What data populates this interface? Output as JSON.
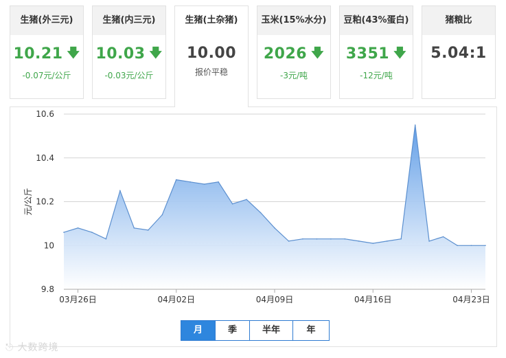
{
  "cards": [
    {
      "title": "生猪(外三元)",
      "price": "10.21",
      "change": "-0.07元/公斤",
      "trend": "down"
    },
    {
      "title": "生猪(内三元)",
      "price": "10.03",
      "change": "-0.03元/公斤",
      "trend": "down"
    },
    {
      "title": "生猪(土杂猪)",
      "price": "10.00",
      "change": "报价平稳",
      "trend": "flat"
    },
    {
      "title": "玉米(15%水分)",
      "price": "2026",
      "change": "-3元/吨",
      "trend": "down"
    },
    {
      "title": "豆粕(43%蛋白)",
      "price": "3351",
      "change": "-12元/吨",
      "trend": "down"
    },
    {
      "title": "猪粮比",
      "price": "5.04:1",
      "change": "",
      "trend": "flat"
    }
  ],
  "icons": {
    "down": "arrow-down-icon"
  },
  "colors": {
    "down": "#3fa64a",
    "accent": "#2e86de",
    "area_top": "#5b9ae6",
    "area_bottom": "#ffffff"
  },
  "ranges": {
    "month": "月",
    "season": "季",
    "half_year": "半年",
    "year": "年",
    "selected": "月"
  },
  "watermark": "大数跨境",
  "chart_data": {
    "type": "area",
    "ylabel": "元/公斤",
    "ylim": [
      9.8,
      10.6
    ],
    "yticks": [
      9.8,
      10,
      10.2,
      10.4,
      10.6
    ],
    "ytick_labels": [
      "9.8",
      "10",
      "10.2",
      "10.4",
      "10.6"
    ],
    "x": [
      "03月25日",
      "03月26日",
      "03月27日",
      "03月28日",
      "03月29日",
      "03月30日",
      "03月31日",
      "04月01日",
      "04月02日",
      "04月03日",
      "04月04日",
      "04月05日",
      "04月06日",
      "04月07日",
      "04月08日",
      "04月09日",
      "04月10日",
      "04月11日",
      "04月12日",
      "04月13日",
      "04月14日",
      "04月15日",
      "04月16日",
      "04月17日",
      "04月18日",
      "04月19日",
      "04月20日",
      "04月21日",
      "04月22日",
      "04月23日",
      "04月24日"
    ],
    "xtick_labels": [
      "03月26日",
      "04月02日",
      "04月09日",
      "04月16日",
      "04月23日"
    ],
    "values": [
      10.06,
      10.08,
      10.06,
      10.03,
      10.25,
      10.08,
      10.07,
      10.14,
      10.3,
      10.29,
      10.28,
      10.29,
      10.19,
      10.21,
      10.15,
      10.08,
      10.02,
      10.03,
      10.03,
      10.03,
      10.03,
      10.02,
      10.01,
      10.02,
      10.03,
      10.55,
      10.02,
      10.04,
      10.0,
      10.0,
      10.0
    ],
    "grid": true,
    "legend": "none"
  }
}
